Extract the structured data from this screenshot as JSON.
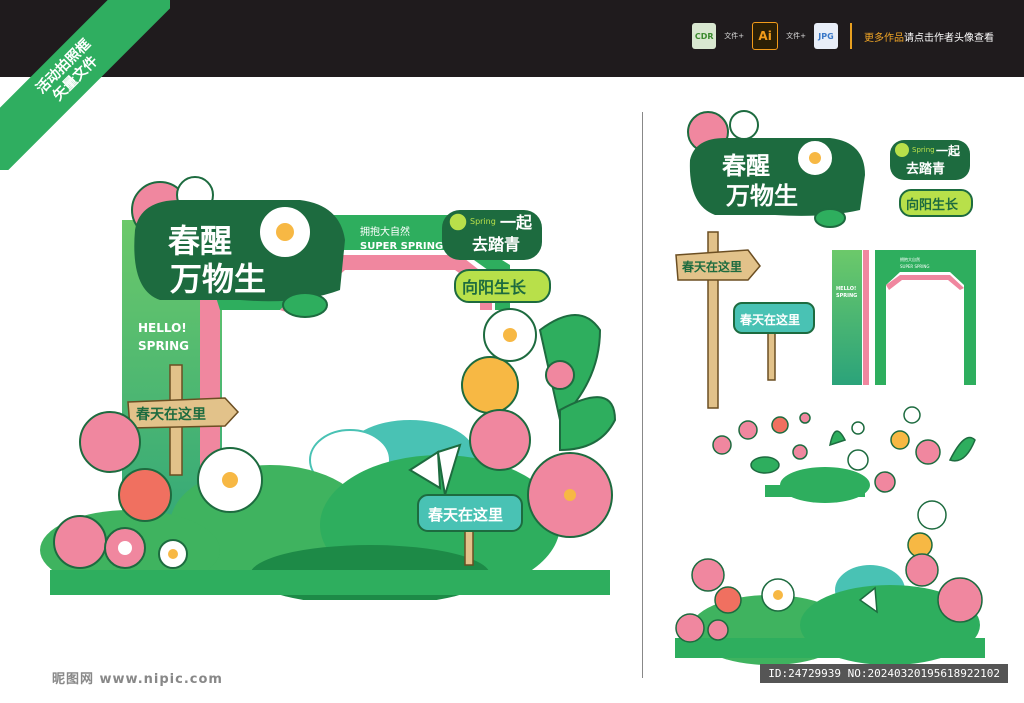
{
  "corner_badge": {
    "line1": "活动拍照框",
    "line2": "矢量文件"
  },
  "filebar": {
    "cdr_label": "CDR",
    "ai_label": "Ai",
    "jpg_label": "JPG",
    "file_text_1": "文件+",
    "file_text_2": "文件+",
    "more_highlight": "更多作品",
    "more_rest": "请点击作者头像查看"
  },
  "main_frame": {
    "title_line1": "春醒",
    "title_line2": "万物生",
    "tagline_cn": "拥抱大自然",
    "tagline_en": "SUPER SPRING",
    "badge_spring": "Spring",
    "badge_cn1": "一起",
    "badge_cn2": "去踏青",
    "sign_grow": "向阳生长",
    "hello_line1": "HELLO!",
    "hello_line2": "SPRING",
    "arrow_sign": "春天在这里",
    "bush_sign": "春天在这里"
  },
  "parts": {
    "title_line1": "春醒",
    "title_line2": "万物生",
    "badge_spring": "Spring",
    "badge_cn1": "一起",
    "badge_cn2": "去踏青",
    "sign_grow": "向阳生长",
    "arrow_sign": "春天在这里",
    "post_sign": "春天在这里",
    "pillar_hello": "HELLO!",
    "pillar_spring": "SPRING",
    "arch_small1": "拥抱大自然",
    "arch_small2": "SUPER SPRING"
  },
  "footer": {
    "logo": "昵图网 www.nipic.com",
    "id_text": "ID:24729939 NO:20240320195618922102"
  },
  "colors": {
    "green_dark": "#1d6b3f",
    "green": "#2eae5e",
    "green_light": "#6cc96a",
    "pink": "#f0879f",
    "teal": "#49c2b4",
    "lime": "#b8e04a"
  }
}
